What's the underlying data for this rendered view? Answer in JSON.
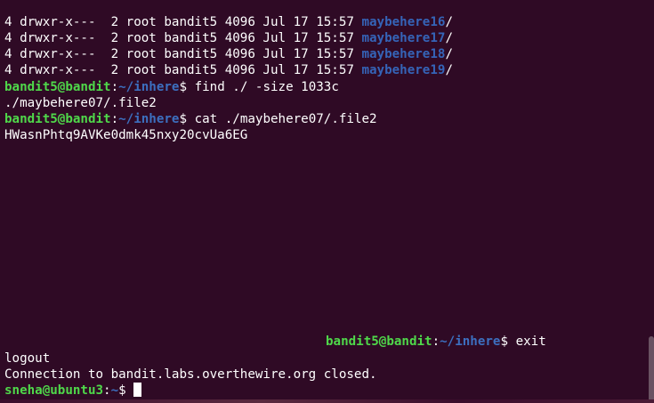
{
  "colors": {
    "background": "#2f0a25",
    "prompt_user": "#4fd84a",
    "prompt_path": "#3c6fbf",
    "directory": "#3564b8",
    "text": "#ffffff"
  },
  "listing": [
    {
      "meta": "4 drwxr-x---  2 root bandit5 4096 Jul 17 15:57 ",
      "name": "maybehere16",
      "suffix": "/"
    },
    {
      "meta": "4 drwxr-x---  2 root bandit5 4096 Jul 17 15:57 ",
      "name": "maybehere17",
      "suffix": "/"
    },
    {
      "meta": "4 drwxr-x---  2 root bandit5 4096 Jul 17 15:57 ",
      "name": "maybehere18",
      "suffix": "/"
    },
    {
      "meta": "4 drwxr-x---  2 root bandit5 4096 Jul 17 15:57 ",
      "name": "maybehere19",
      "suffix": "/"
    }
  ],
  "commands": [
    {
      "user": "bandit5@bandit",
      "sep": ":",
      "path": "~/inhere",
      "symbol": "$ ",
      "cmd": "find ./ -size 1033c"
    },
    {
      "output": "./maybehere07/.file2"
    },
    {
      "user": "bandit5@bandit",
      "sep": ":",
      "path": "~/inhere",
      "symbol": "$ ",
      "cmd": "cat ./maybehere07/.file2"
    },
    {
      "output": "HWasnPhtq9AVKe0dmk45nxy20cvUa6EG"
    }
  ],
  "exit_prompt": {
    "user": "bandit5@bandit",
    "sep": ":",
    "path": "~/inhere",
    "symbol": "$ ",
    "cmd": "exit"
  },
  "logout_text": "logout",
  "connection_text": "Connection to bandit.labs.overthewire.org closed.",
  "local_prompt": {
    "user": "sneha@ubuntu3",
    "sep": ":",
    "path": "~",
    "symbol": "$ "
  }
}
